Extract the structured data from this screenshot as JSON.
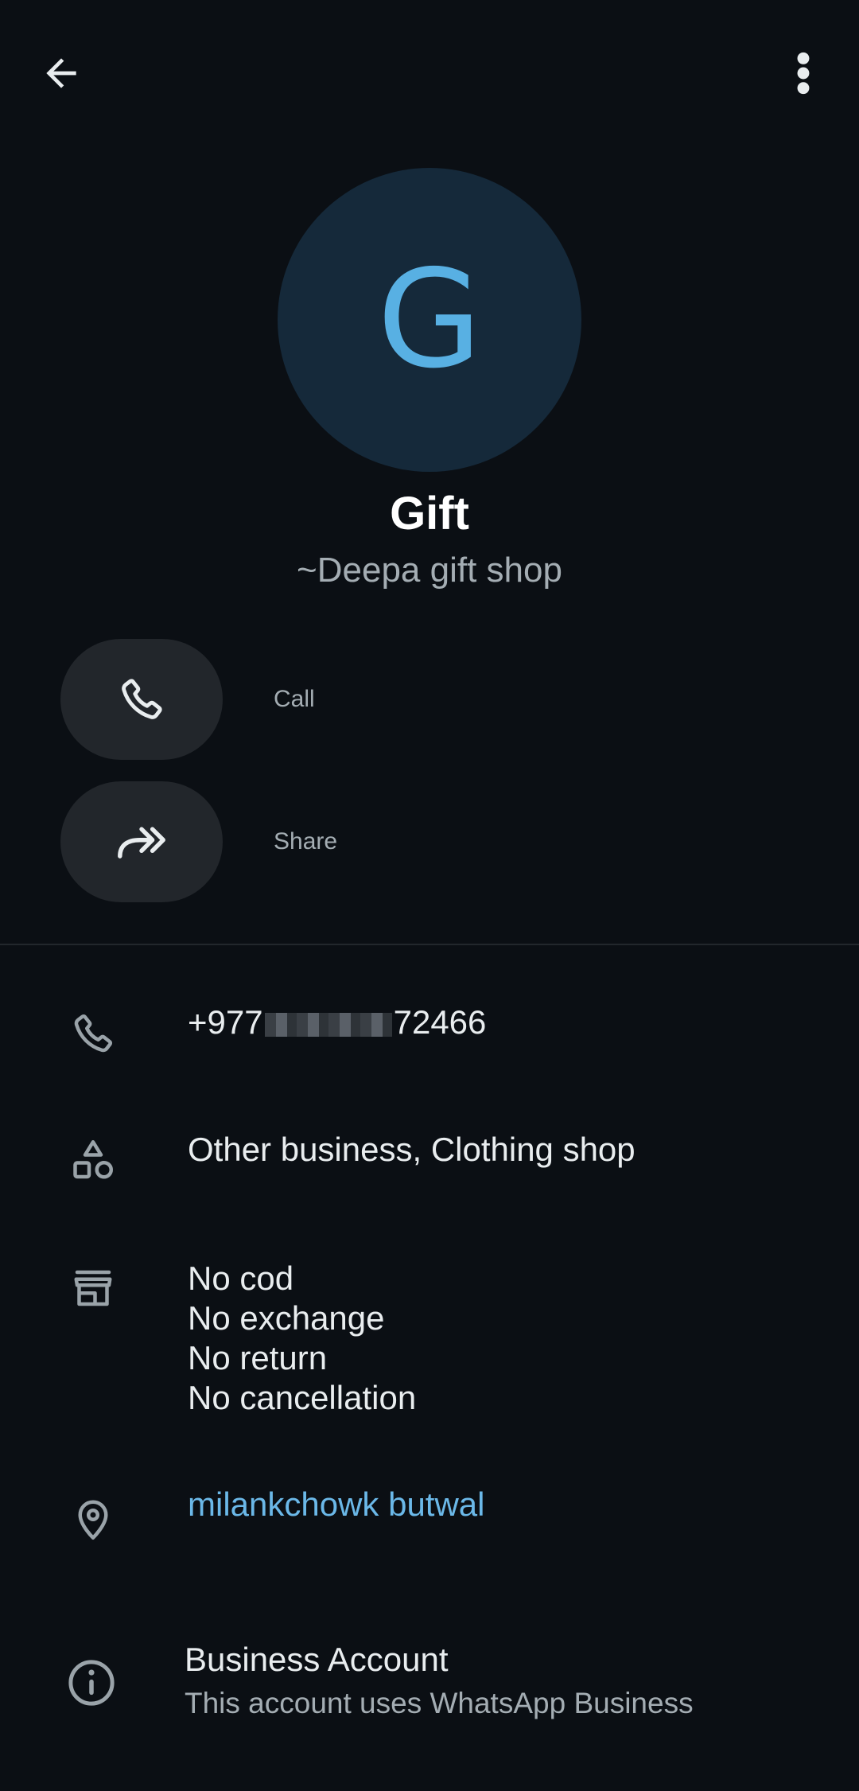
{
  "header": {
    "back_icon": "arrow-left-icon",
    "more_icon": "more-vertical-icon"
  },
  "profile": {
    "avatar_letter": "G",
    "name": "Gift",
    "subtitle": "~Deepa gift shop",
    "avatar_bg": "#15293a",
    "avatar_fg": "#58b0e3"
  },
  "actions": [
    {
      "label": "Call",
      "icon": "phone-icon"
    },
    {
      "label": "Share",
      "icon": "share-forward-icon"
    }
  ],
  "info": {
    "phone_prefix": "+977",
    "phone_suffix": "72466",
    "category": "Other business, Clothing shop",
    "description_lines": [
      "No cod",
      "No exchange",
      "No return",
      "No cancellation"
    ],
    "address": "milankchowk butwal"
  },
  "business": {
    "title": "Business Account",
    "subtitle": "This account uses WhatsApp Business"
  }
}
